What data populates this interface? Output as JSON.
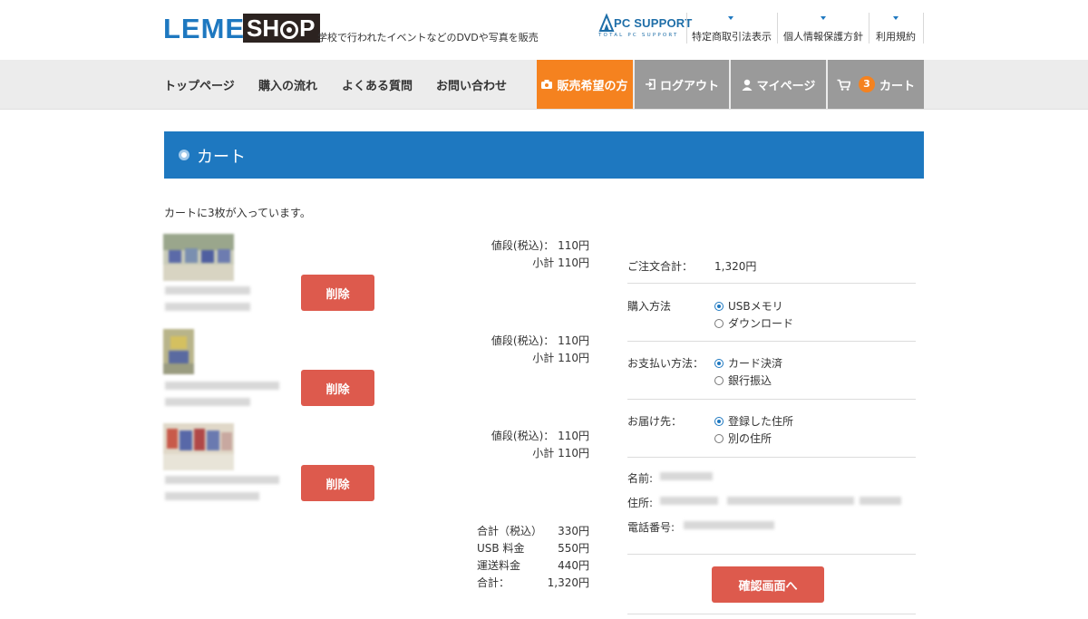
{
  "header": {
    "logo_text_1": "LEME",
    "logo_text_2": "SH",
    "logo_text_3": "P",
    "tagline": "学校で行われたイベントなどのDVDや写真を販売",
    "pc_support_title": "PC SUPPORT",
    "pc_support_sub": "TOTAL PC SUPPORT",
    "links": [
      "特定商取引法表示",
      "個人情報保護方針",
      "利用規約"
    ]
  },
  "nav": {
    "items": [
      "トップページ",
      "購入の流れ",
      "よくある質問",
      "お問い合わせ"
    ],
    "sell_label": "販売希望の方",
    "logout_label": "ログアウト",
    "mypage_label": "マイページ",
    "cart_count": "3",
    "cart_label": "カート"
  },
  "page_title": "カート",
  "cart_message": "カートに3枚が入っています。",
  "items": [
    {
      "price_label": "値段(税込)：",
      "price": "110円",
      "subtotal_label": "小計",
      "subtotal": "110円",
      "delete_label": "削除"
    },
    {
      "price_label": "値段(税込)：",
      "price": "110円",
      "subtotal_label": "小計",
      "subtotal": "110円",
      "delete_label": "削除"
    },
    {
      "price_label": "値段(税込)：",
      "price": "110円",
      "subtotal_label": "小計",
      "subtotal": "110円",
      "delete_label": "削除"
    }
  ],
  "totals": [
    {
      "label": "合計（税込）",
      "value": "330円"
    },
    {
      "label": "USB 料金",
      "value": "550円"
    },
    {
      "label": "運送料金",
      "value": "440円"
    },
    {
      "label": "合計：",
      "value": "1,320円"
    }
  ],
  "order": {
    "total_label": "ご注文合計：",
    "total_value": "1,320円",
    "purchase_label": "購入方法",
    "purchase_options": [
      "USBメモリ",
      "ダウンロード"
    ],
    "purchase_selected": "USBメモリ",
    "payment_label": "お支払い方法：",
    "payment_options": [
      "カード決済",
      "銀行振込"
    ],
    "payment_selected": "カード決済",
    "delivery_label": "お届け先：",
    "delivery_options": [
      "登録した住所",
      "別の住所"
    ],
    "delivery_selected": "登録した住所",
    "name_label": "名前:",
    "address_label": "住所:",
    "phone_label": "電話番号:",
    "confirm_label": "確認画面へ"
  },
  "colors": {
    "brand_blue": "#1e78c0",
    "orange": "#f5821f",
    "red_button": "#dd5a4d",
    "nav_gray": "#9a9a9a"
  }
}
